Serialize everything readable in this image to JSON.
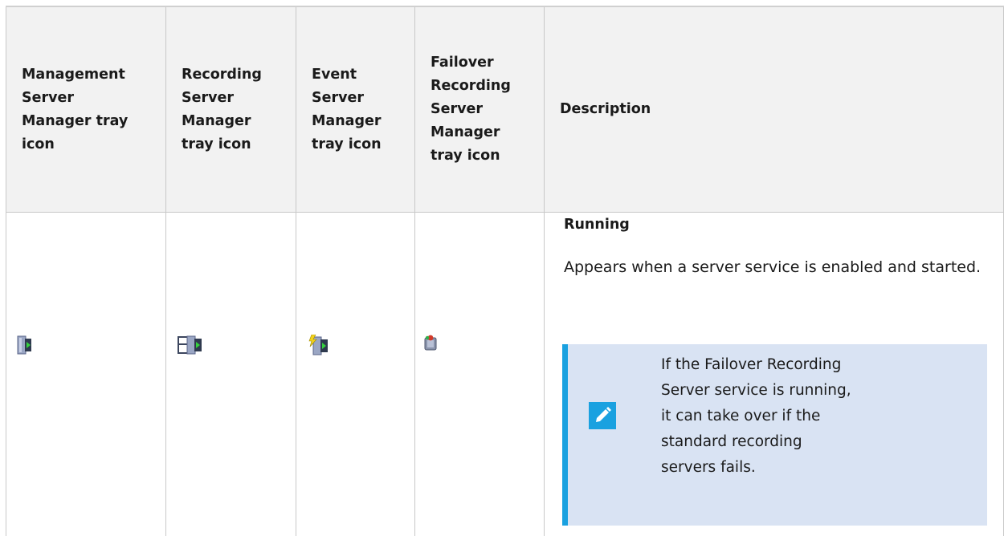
{
  "columns": [
    {
      "label": "Management\nServer\nManager tray\nicon"
    },
    {
      "label": "Recording\nServer\nManager\ntray icon"
    },
    {
      "label": "Event\nServer\nManager\ntray icon"
    },
    {
      "label": "Failover\nRecording\nServer\nManager\ntray icon"
    },
    {
      "label": "Description"
    }
  ],
  "row": {
    "icons": [
      "management-server-running-icon",
      "recording-server-running-icon",
      "event-server-running-icon",
      "failover-recording-server-running-icon"
    ],
    "status_title": "Running",
    "description": "Appears when a server service is enabled and started.",
    "note": {
      "icon": "pencil-icon",
      "text": "If the Failover Recording\nServer service is running,\nit can take over if the\nstandard recording\nservers fails."
    }
  },
  "colors": {
    "header_bg": "#f2f2f2",
    "note_bg": "#d9e3f3",
    "note_accent": "#1aa1e0",
    "grid": "#c8c8c8"
  }
}
